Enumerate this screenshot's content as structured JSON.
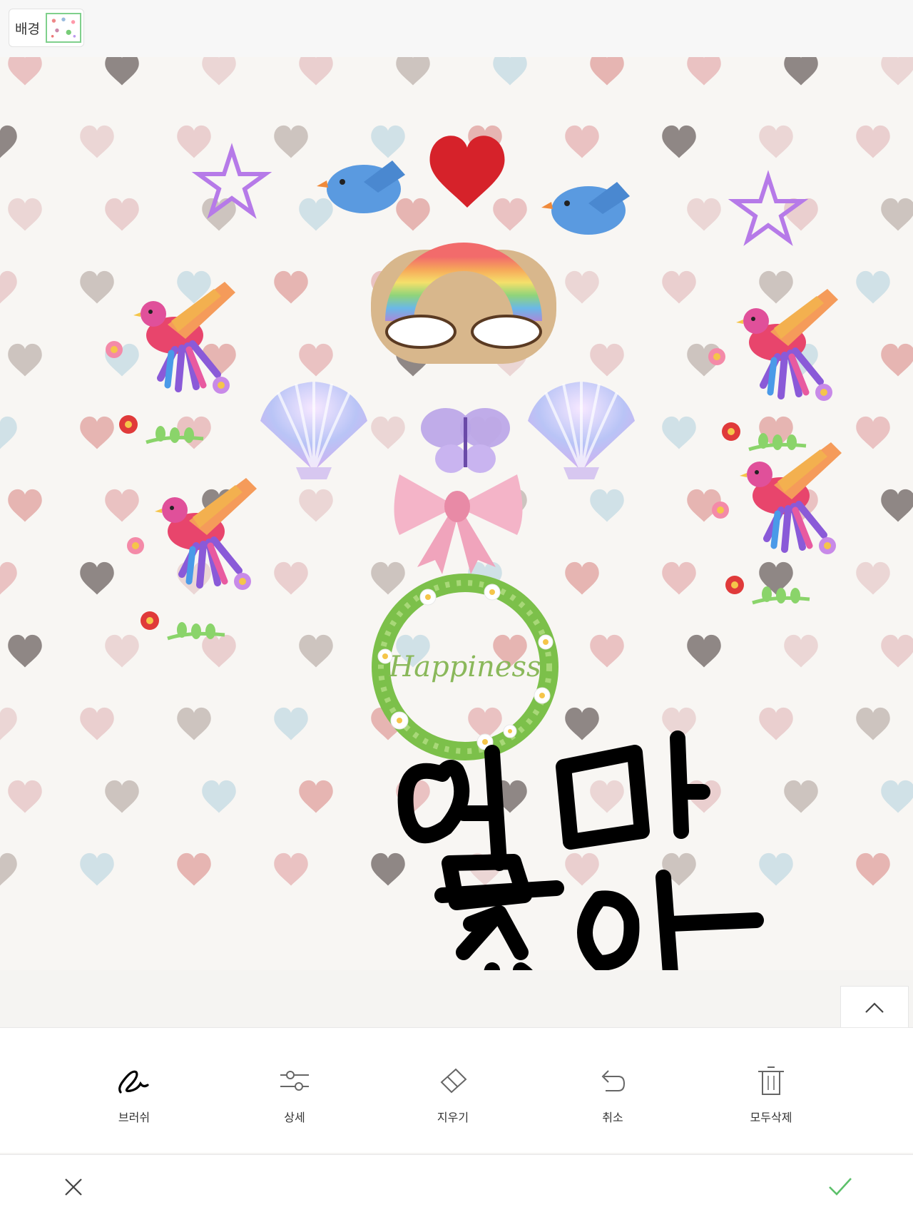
{
  "background_selector": {
    "label": "배경"
  },
  "canvas": {
    "wreath_text": "Happiness",
    "handwriting": [
      "엄마",
      "좋아"
    ]
  },
  "toolbar": {
    "brush_label": "브러쉬",
    "detail_label": "상세",
    "eraser_label": "지우기",
    "undo_label": "취소",
    "delete_all_label": "모두삭제"
  },
  "colors": {
    "confirm": "#5cc06a",
    "ink": "#000000"
  }
}
